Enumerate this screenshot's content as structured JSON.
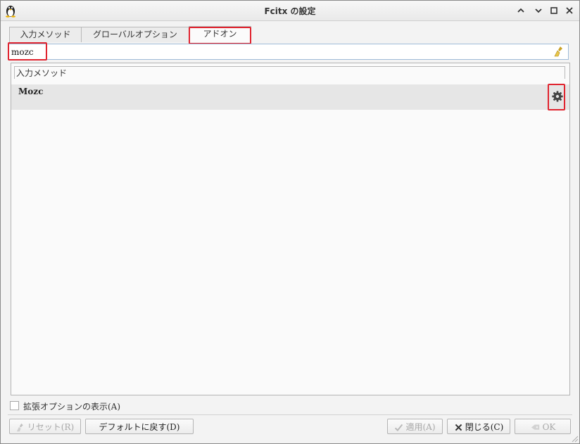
{
  "window": {
    "title": "Fcitx の設定",
    "controls": {
      "minimize": "⌃",
      "restore": "⌄",
      "maximize": "◻",
      "close": "✕"
    }
  },
  "tabs": [
    {
      "label": "入力メソッド",
      "active": false
    },
    {
      "label": "グローバルオプション",
      "active": false
    },
    {
      "label": "アドオン",
      "active": true
    }
  ],
  "search": {
    "value": "mozc",
    "placeholder": ""
  },
  "list": {
    "category": "入力メソッド",
    "items": [
      {
        "name": "Mozc",
        "selected": true,
        "icon": "gear-icon"
      }
    ]
  },
  "advanced_option": {
    "label": "拡張オプションの表示(A)",
    "checked": false
  },
  "buttons": {
    "reset": {
      "label": "リセット(R)",
      "enabled": false,
      "icon": "brush-icon"
    },
    "default": {
      "label": "デフォルトに戻す(D)",
      "enabled": true
    },
    "apply": {
      "label": "適用(A)",
      "enabled": false,
      "icon": "check-icon"
    },
    "close": {
      "label": "閉じる(C)",
      "enabled": true,
      "icon": "x-icon"
    },
    "ok": {
      "label": "OK",
      "enabled": false,
      "icon": "ok-icon"
    }
  },
  "colors": {
    "highlight": "#e0242f",
    "selected_row": "#e6e6e6",
    "window_bg": "#f3f3f3"
  }
}
